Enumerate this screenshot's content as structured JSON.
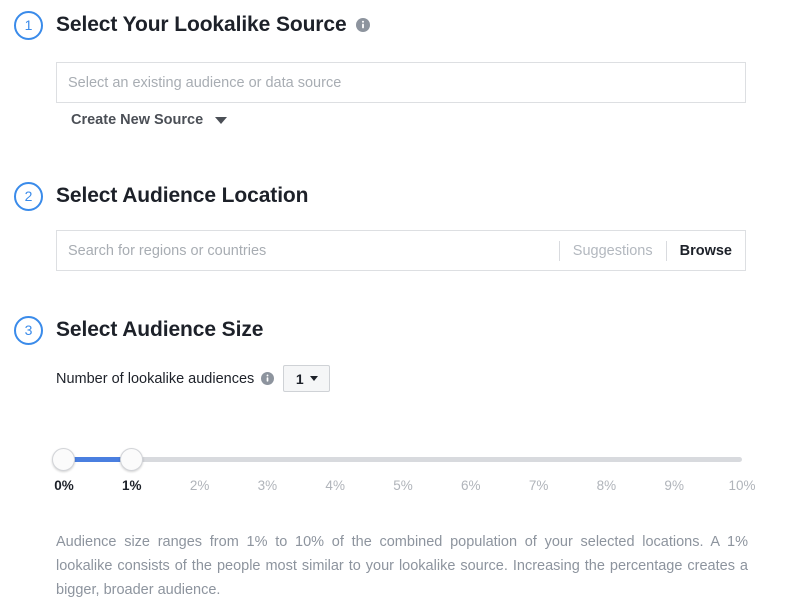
{
  "accent_color": "#3a8bea",
  "slider_fill_color": "#4a7fe0",
  "sections": [
    {
      "step": "1",
      "title": "Select Your Lookalike Source",
      "info_icon": "info-icon",
      "input_placeholder": "Select an existing audience or data source",
      "create_link": "Create New Source",
      "create_caret_icon": "chevron-down-icon"
    },
    {
      "step": "2",
      "title": "Select Audience Location",
      "input_placeholder": "Search for regions or countries",
      "suggestions_label": "Suggestions",
      "browse_label": "Browse"
    },
    {
      "step": "3",
      "title": "Select Audience Size",
      "count_label": "Number of lookalike audiences",
      "count_info_icon": "info-icon",
      "count_value": "1",
      "count_caret_icon": "chevron-down-icon"
    }
  ],
  "slider": {
    "min_label": "0%",
    "value_label": "1%",
    "lower_value": 0,
    "upper_value": 1,
    "range_min": 0,
    "range_max": 10,
    "ticks": [
      {
        "label": "0%",
        "value": 0,
        "active": true
      },
      {
        "label": "1%",
        "value": 1,
        "active": true
      },
      {
        "label": "2%",
        "value": 2,
        "active": false
      },
      {
        "label": "3%",
        "value": 3,
        "active": false
      },
      {
        "label": "4%",
        "value": 4,
        "active": false
      },
      {
        "label": "5%",
        "value": 5,
        "active": false
      },
      {
        "label": "6%",
        "value": 6,
        "active": false
      },
      {
        "label": "7%",
        "value": 7,
        "active": false
      },
      {
        "label": "8%",
        "value": 8,
        "active": false
      },
      {
        "label": "9%",
        "value": 9,
        "active": false
      },
      {
        "label": "10%",
        "value": 10,
        "active": false
      }
    ]
  },
  "description": "Audience size ranges from 1% to 10% of the combined population of your selected locations. A 1% lookalike consists of the people most similar to your lookalike source. Increasing the percentage creates a bigger, broader audience."
}
